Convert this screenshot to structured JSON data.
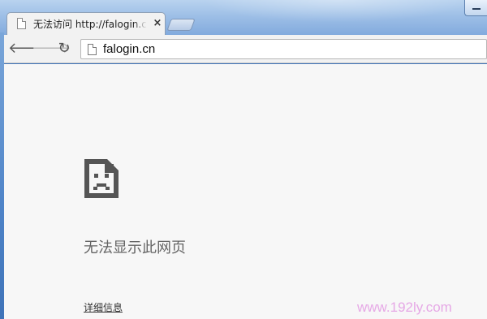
{
  "browser": {
    "tab": {
      "title": "无法访问 http://falogin.cn",
      "close_glyph": "×",
      "favicon": "page-icon"
    },
    "toolbar": {
      "back_glyph": "🡐",
      "forward_glyph": "🡒",
      "reload_glyph": "↻",
      "url": "falogin.cn",
      "url_icon": "page-icon"
    }
  },
  "page": {
    "error_icon": "sad-page-icon",
    "error_title": "无法显示此网页",
    "details_link": "详细信息"
  },
  "watermark": "www.192ly.com",
  "colors": {
    "content_bg": "#f7f7f7",
    "toolbar_bg": "#f2f2f2",
    "frame_blue": "#3f73b8",
    "watermark": "#e6a8e6"
  }
}
